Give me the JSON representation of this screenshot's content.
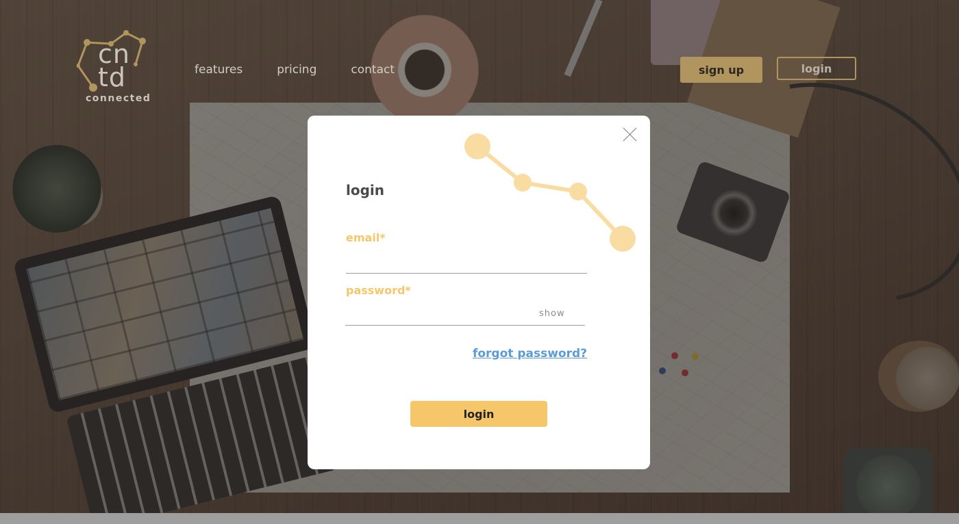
{
  "brand": {
    "logo_letters_top": "cn",
    "logo_letters_bottom": "td",
    "logo_word": "connected",
    "accent": "#b0955f"
  },
  "nav": {
    "items": [
      {
        "label": "features"
      },
      {
        "label": "pricing"
      },
      {
        "label": "contact"
      }
    ]
  },
  "header": {
    "signup_label": "sign up",
    "login_label": "login"
  },
  "modal": {
    "title": "login",
    "email_label": "email*",
    "email_value": "",
    "password_label": "password*",
    "password_value": "",
    "show_label": "show",
    "forgot_label": "forgot password?",
    "submit_label": "login",
    "accent": "#f6c76a",
    "link_color": "#5b9bd8"
  },
  "icons": {
    "close": "close-icon"
  }
}
